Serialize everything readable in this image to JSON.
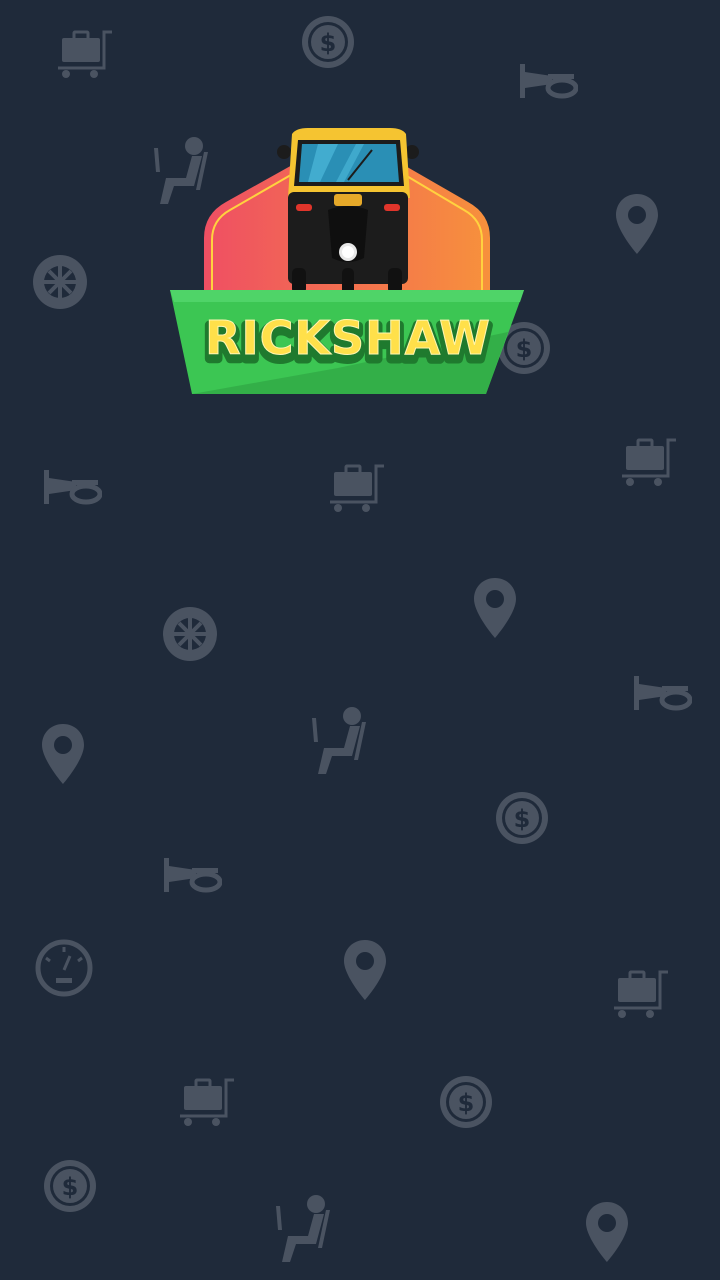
{
  "app": {
    "brand_name": "RICKSHAW"
  },
  "colors": {
    "background": "#1f2a3a",
    "pattern_icon": "#4a5361",
    "banner_green": "#3cc653",
    "banner_green_dark": "#2fa544",
    "badge_red": "#ef4f63",
    "badge_orange": "#f7913c",
    "rickshaw_yellow": "#f5c431",
    "rickshaw_black": "#1c1c1c",
    "text_yellow": "#ffe04a",
    "text_outline": "#1f7a2e"
  },
  "background_icons": [
    "luggage-cart-icon",
    "dollar-coin-icon",
    "horn-icon",
    "driver-seat-icon",
    "location-pin-icon",
    "wheel-icon",
    "dollar-coin-icon",
    "luggage-cart-icon",
    "horn-icon",
    "luggage-cart-icon",
    "location-pin-icon",
    "wheel-icon",
    "horn-icon",
    "location-pin-icon",
    "driver-seat-icon",
    "dollar-coin-icon",
    "horn-icon",
    "speedometer-icon",
    "location-pin-icon",
    "luggage-cart-icon",
    "luggage-cart-icon",
    "dollar-coin-icon",
    "dollar-coin-icon",
    "driver-seat-icon",
    "location-pin-icon"
  ]
}
